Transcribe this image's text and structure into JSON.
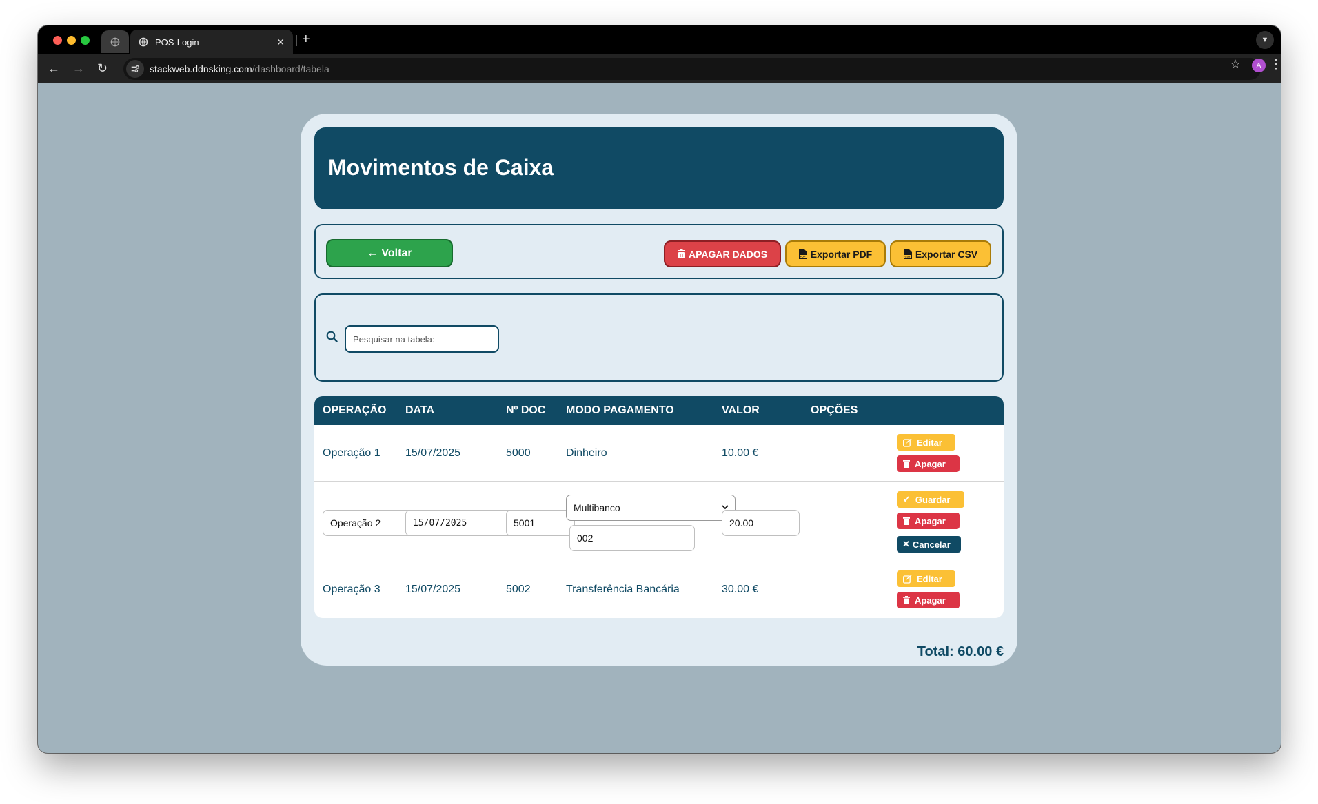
{
  "browser": {
    "tab_title": "POS-Login",
    "url_host": "stackweb.ddnsking.com",
    "url_path": "/dashboard/tabela",
    "profile_initial": "A"
  },
  "page": {
    "title": "Movimentos de Caixa",
    "buttons": {
      "back": "Voltar",
      "delete_all": "APAGAR DADOS",
      "export_pdf": "Exportar PDF",
      "export_csv": "Exportar CSV"
    },
    "search": {
      "placeholder": "Pesquisar na tabela:"
    },
    "table": {
      "headers": [
        "OPERAÇÃO",
        "DATA",
        "Nº DOC",
        "MODO PAGAMENTO",
        "VALOR",
        "OPÇÕES"
      ],
      "rows": [
        {
          "operacao": "Operação 1",
          "data": "15/07/2025",
          "doc": "5000",
          "modo": "Dinheiro",
          "valor": "10.00 €"
        },
        {
          "operacao": "Operação 2",
          "data": "15/07/2025",
          "doc": "5001",
          "modo": "Multibanco",
          "modo_ref": "002",
          "valor": "20.00",
          "editing": true
        },
        {
          "operacao": "Operação 3",
          "data": "15/07/2025",
          "doc": "5002",
          "modo": "Transferência Bancária",
          "valor": "30.00 €"
        }
      ],
      "actions": {
        "edit": "Editar",
        "delete": "Apagar",
        "save": "Guardar",
        "cancel": "Cancelar"
      },
      "edit_date_display": "15/07/2025"
    },
    "total": "Total: 60.00 €"
  },
  "colors": {
    "primary": "#104a64",
    "success": "#2da34c",
    "danger": "#dc3545",
    "warning": "#fbc035",
    "background": "#a1b3bd",
    "card": "#e2ecf3"
  }
}
